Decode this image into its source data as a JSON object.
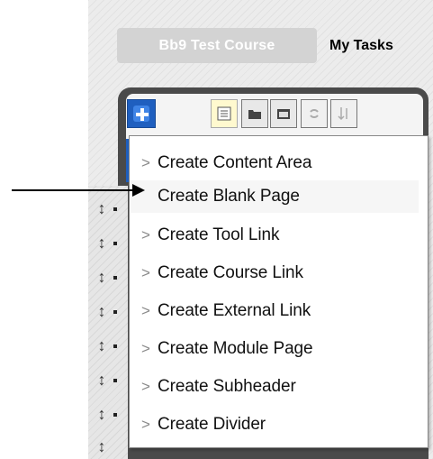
{
  "course_bar": {
    "course_tab_label": "Bb9 Test Course",
    "tasks_tab_label": "My Tasks"
  },
  "toolbar": {
    "add_button_icon": "plus-icon",
    "tools": [
      {
        "name": "document-icon"
      },
      {
        "name": "folder-icon"
      },
      {
        "name": "window-icon"
      },
      {
        "name": "refresh-icon"
      },
      {
        "name": "sort-arrows-icon"
      }
    ]
  },
  "menu": {
    "items": [
      {
        "label": "Create Content Area",
        "chevron": ">"
      },
      {
        "label": "Create Blank Page",
        "chevron": ""
      },
      {
        "label": "Create Tool Link",
        "chevron": ">"
      },
      {
        "label": "Create Course Link",
        "chevron": ">"
      },
      {
        "label": "Create External Link",
        "chevron": ">"
      },
      {
        "label": "Create Module Page",
        "chevron": ">"
      },
      {
        "label": "Create Subheader",
        "chevron": ">"
      },
      {
        "label": "Create Divider",
        "chevron": ">"
      }
    ]
  },
  "colors": {
    "accent_blue": "#1f5fbf",
    "panel_dark": "#4a4a4a",
    "course_tab": "#d3d3d3"
  }
}
